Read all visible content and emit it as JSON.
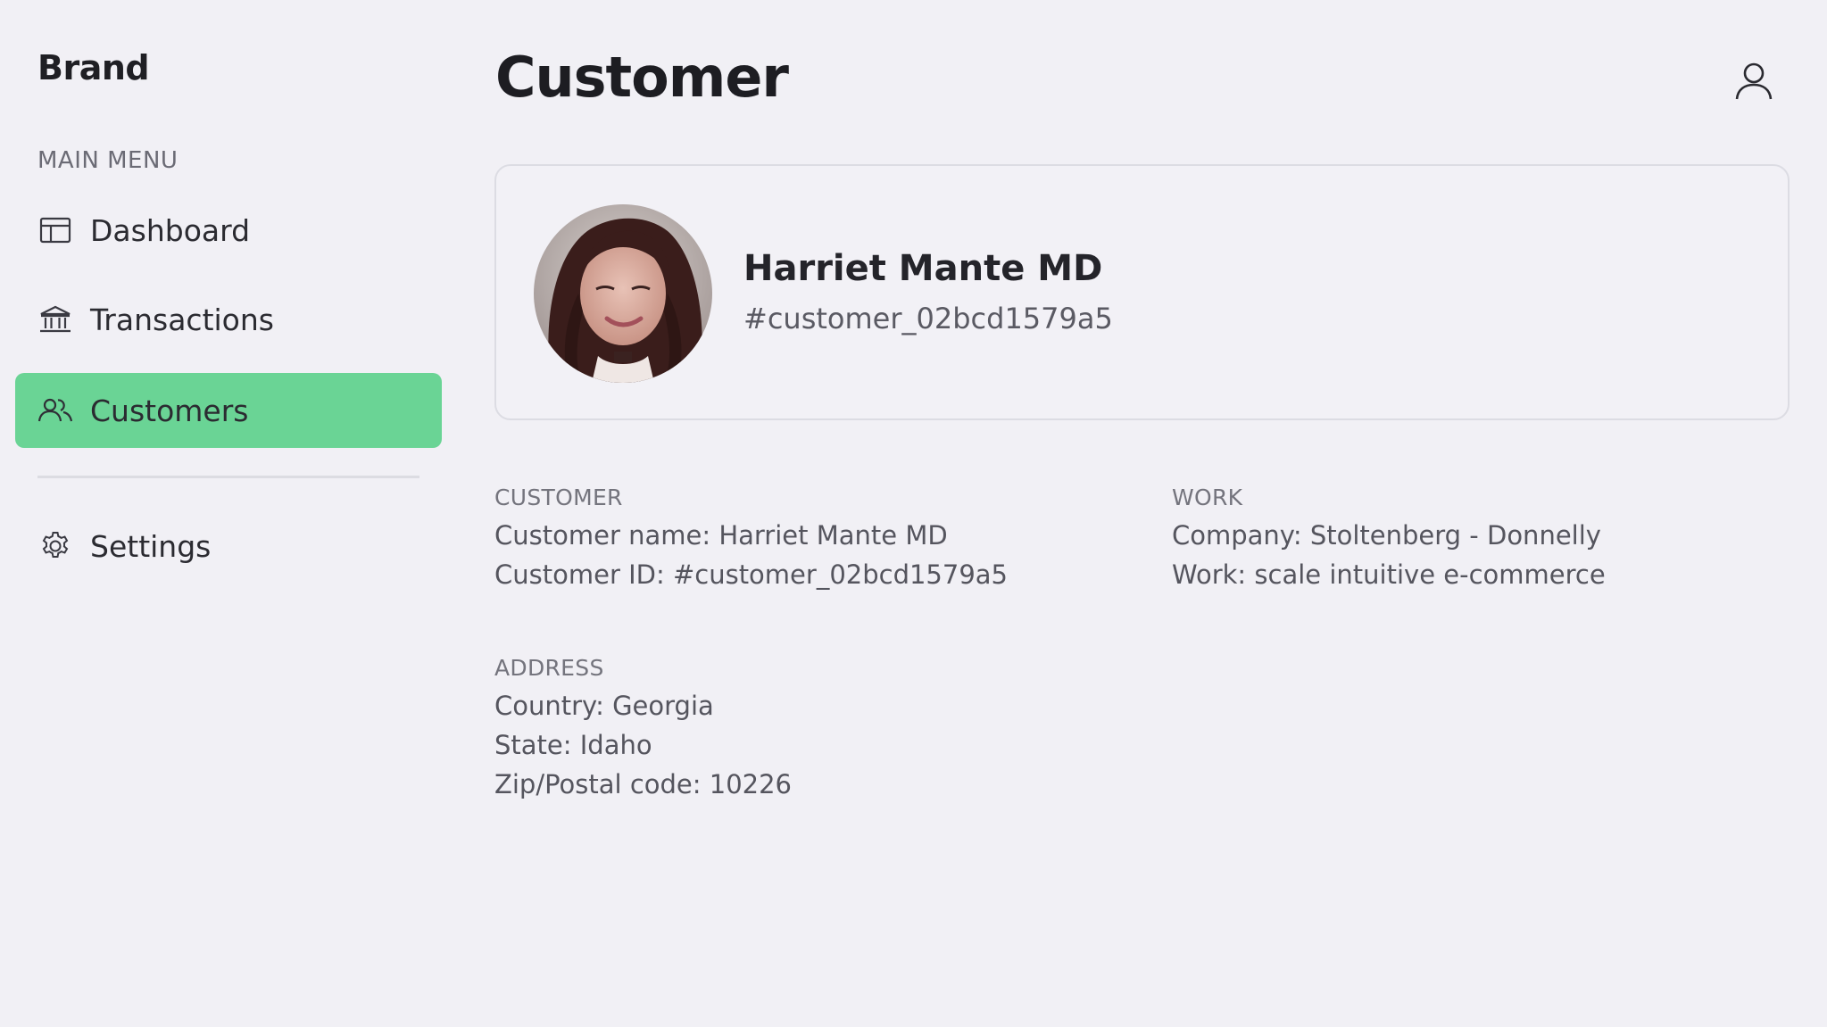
{
  "sidebar": {
    "brand": "Brand",
    "menu_heading": "MAIN MENU",
    "items": [
      {
        "label": "Dashboard",
        "icon": "dashboard-icon",
        "active": false
      },
      {
        "label": "Transactions",
        "icon": "bank-icon",
        "active": false
      },
      {
        "label": "Customers",
        "icon": "users-icon",
        "active": true
      },
      {
        "label": "Settings",
        "icon": "gear-icon",
        "active": false
      }
    ]
  },
  "header": {
    "title": "Customer",
    "user_icon": "user-icon"
  },
  "profile": {
    "name": "Harriet Mante MD",
    "customer_id": "#customer_02bcd1579a5"
  },
  "details": {
    "customer": {
      "heading": "CUSTOMER",
      "name_line": "Customer name: Harriet Mante MD",
      "id_line": "Customer ID: #customer_02bcd1579a5"
    },
    "work": {
      "heading": "WORK",
      "company_line": "Company: Stoltenberg - Donnelly",
      "work_line": "Work: scale intuitive e-commerce"
    },
    "address": {
      "heading": "ADDRESS",
      "country_line": "Country: Georgia",
      "state_line": "State: Idaho",
      "zip_line": "Zip/Postal code: 10226"
    }
  },
  "colors": {
    "background": "#f1f0f5",
    "active_nav": "#6ad495",
    "card_border": "#dcdce3"
  }
}
